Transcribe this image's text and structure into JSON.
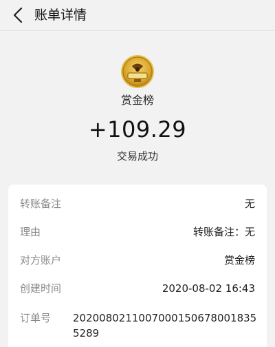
{
  "nav": {
    "title": "账单详情",
    "back_icon": "chevron-left-icon"
  },
  "hero": {
    "avatar_icon": "merchant-logo-icon",
    "merchant": "赏金榜",
    "amount": "+109.29",
    "status": "交易成功"
  },
  "details": [
    {
      "key": "转账备注",
      "value": "无"
    },
    {
      "key": "理由",
      "value": "转账备注：无"
    },
    {
      "key": "对方账户",
      "value": "赏金榜"
    },
    {
      "key": "创建时间",
      "value": "2020-08-02 16:43"
    },
    {
      "key": "订单号",
      "value": "20200802110070001506780018355289"
    }
  ],
  "colors": {
    "background": "#f2f2f2",
    "card": "#ffffff",
    "label": "#8a8a8a"
  }
}
